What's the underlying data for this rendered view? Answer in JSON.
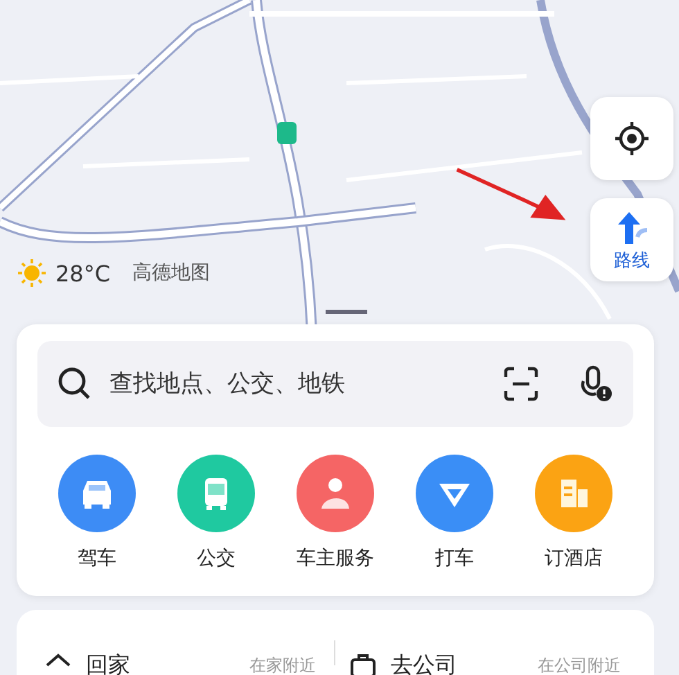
{
  "map_controls": {
    "locate": {
      "kind": "locate"
    },
    "route": {
      "label": "路线"
    }
  },
  "weather": {
    "temperature": "28°C",
    "brand": "高德地图"
  },
  "search": {
    "placeholder": "查找地点、公交、地铁"
  },
  "services": [
    {
      "label": "驾车",
      "kind": "car",
      "color": "#3d8cf5"
    },
    {
      "label": "公交",
      "kind": "bus",
      "color": "#1fc9a0"
    },
    {
      "label": "车主服务",
      "kind": "owner",
      "color": "#f56565"
    },
    {
      "label": "打车",
      "kind": "taxi",
      "color": "#3a8ef6"
    },
    {
      "label": "订酒店",
      "kind": "hotel",
      "color": "#fba313"
    }
  ],
  "shortcuts": [
    {
      "kind": "home",
      "label": "回家",
      "hint": "在家附近"
    },
    {
      "kind": "work",
      "label": "去公司",
      "hint": "在公司附近"
    }
  ]
}
